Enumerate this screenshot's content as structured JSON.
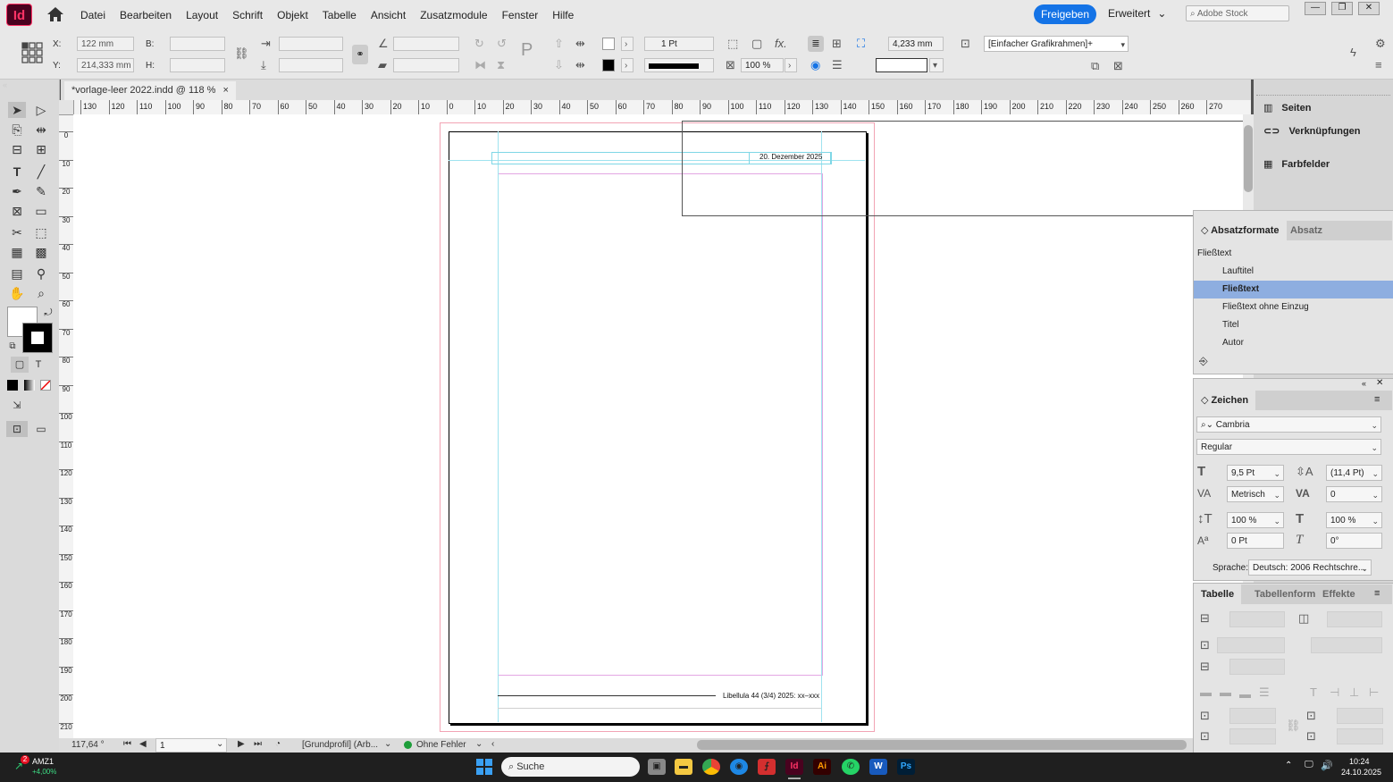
{
  "app": {
    "icon_label": "Id",
    "accent": "#ff3366",
    "share_color": "#1473e6"
  },
  "menu": [
    "Datei",
    "Bearbeiten",
    "Layout",
    "Schrift",
    "Objekt",
    "Tabelle",
    "Ansicht",
    "Zusatzmodule",
    "Fenster",
    "Hilfe"
  ],
  "header": {
    "share_label": "Freigeben",
    "workspace_label": "Erweitert",
    "stock_placeholder": "Adobe Stock"
  },
  "window_buttons": [
    "—",
    "❐",
    "✕"
  ],
  "control": {
    "x_label": "X:",
    "x_value": "122 mm",
    "y_label": "Y:",
    "y_value": "214,333 mm",
    "b_label": "B:",
    "h_label": "H:",
    "stroke_weight": "1 Pt",
    "opacity": "100 %",
    "offset_value": "4,233 mm",
    "object_style": "[Einfacher Grafikrahmen]+"
  },
  "document": {
    "tab_title": "*vorlage-leer 2022.indd @ 118 %",
    "close_glyph": "×"
  },
  "page": {
    "header_date": "20. Dezember 2025",
    "footer_text": "Libellula 44 (3/4) 2025: xx–xxx"
  },
  "ruler_h": [
    "130",
    "120",
    "110",
    "100",
    "90",
    "80",
    "70",
    "60",
    "50",
    "40",
    "30",
    "20",
    "10",
    "0",
    "10",
    "20",
    "30",
    "40",
    "50",
    "60",
    "70",
    "80",
    "90",
    "100",
    "110",
    "120",
    "130",
    "140",
    "150",
    "160",
    "170",
    "180",
    "190",
    "200",
    "210",
    "220",
    "230",
    "240",
    "250",
    "260",
    "270"
  ],
  "ruler_v": [
    "0",
    "10",
    "20",
    "30",
    "40",
    "50",
    "60",
    "70",
    "80",
    "90",
    "100",
    "110",
    "120",
    "130",
    "140",
    "150",
    "160",
    "170",
    "180",
    "190",
    "200",
    "210"
  ],
  "status": {
    "zoom": "117,64 °",
    "page_number": "1",
    "profile": "[Grundprofil] (Arb...",
    "preflight": "Ohne Fehler",
    "preflight_color": "#1e9e3a"
  },
  "dock": {
    "items": [
      "Seiten",
      "Verknüpfungen",
      "Farbfelder"
    ]
  },
  "para_panel": {
    "tabs": [
      "Absatzformate",
      "Absatz"
    ],
    "current": "Fließtext",
    "styles": [
      "Lauftitel",
      "Fließtext",
      "Fließtext ohne Einzug",
      "Titel",
      "Autor"
    ],
    "selected_index": 1,
    "selected_color": "#8eaee0"
  },
  "char_panel": {
    "title": "Zeichen",
    "font": "Cambria",
    "style": "Regular",
    "size": "9,5 Pt",
    "leading": "(11,4 Pt)",
    "kerning": "Metrisch",
    "tracking": "0",
    "vscale": "100 %",
    "hscale": "100 %",
    "baseline": "0 Pt",
    "skew": "0°",
    "lang_label": "Sprache:",
    "lang_value": "Deutsch: 2006 Rechtschre..."
  },
  "table_panel": {
    "tabs": [
      "Tabelle",
      "Tabellenform",
      "Effekte"
    ]
  },
  "taskbar": {
    "stock_ticker": "AMZ1",
    "stock_change": "+4,00%",
    "badge": "2",
    "search_placeholder": "Suche",
    "time": "10:24",
    "date": "24.10.2025",
    "apps": [
      "Id",
      "Ai",
      "W",
      "Ps"
    ]
  }
}
